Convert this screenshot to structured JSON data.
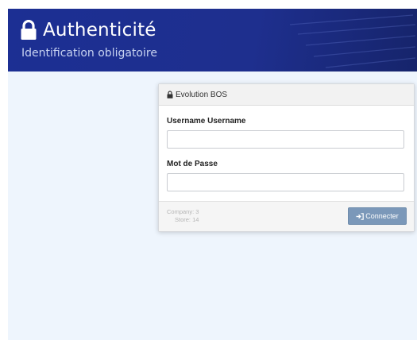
{
  "header": {
    "title": "Authenticité",
    "subtitle": "Identification obligatoire",
    "lock_icon": "lock-icon",
    "background_color": "#1e2f8e",
    "title_color": "#ffffff"
  },
  "login_panel": {
    "heading": "Evolution BOS",
    "heading_icon": "lock-icon",
    "fields": [
      {
        "label": "Username Username",
        "value": "",
        "placeholder": ""
      },
      {
        "label": "Mot de Passe",
        "value": "",
        "placeholder": ""
      }
    ],
    "footer": {
      "company": "Company: 3",
      "store": "Store: 14"
    },
    "connect_button": {
      "label": "Connecter",
      "icon": "sign-in-icon",
      "color": "#7b98b9"
    }
  },
  "page_background": "#eef5fd"
}
